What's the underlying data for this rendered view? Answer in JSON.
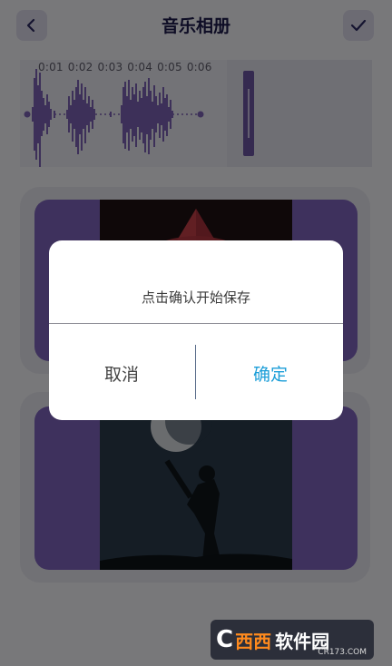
{
  "header": {
    "title": "音乐相册",
    "back_icon": "chevron-left-icon",
    "confirm_icon": "check-icon"
  },
  "waveform": {
    "time_ticks": [
      "0:01",
      "0:02",
      "0:03",
      "0:04",
      "0:05",
      "0:06"
    ],
    "wave_color": "#7a61b3"
  },
  "dialog": {
    "message": "点击确认开始保存",
    "cancel_label": "取消",
    "confirm_label": "确定"
  },
  "watermark": {
    "mark": "C",
    "xi": "西西",
    "name": "软件园",
    "url": "CR173.COM"
  },
  "colors": {
    "accent": "#7c62ba",
    "confirm_text": "#1c9ed8"
  }
}
